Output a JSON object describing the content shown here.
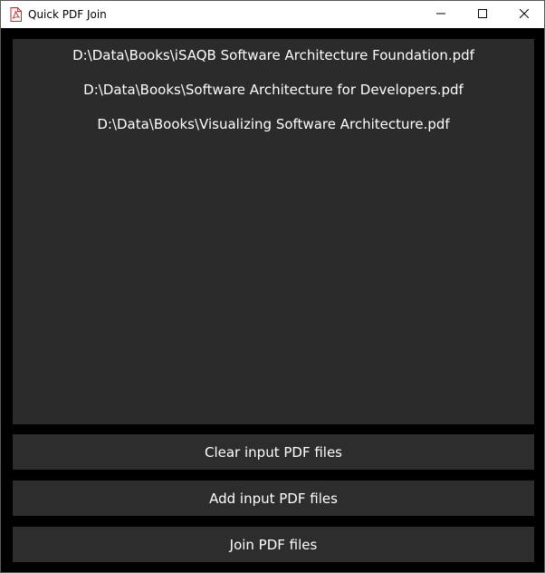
{
  "window": {
    "title": "Quick PDF Join",
    "app_icon": "pdf-document-icon",
    "controls": {
      "minimize_icon": "minimize-icon",
      "maximize_icon": "maximize-icon",
      "close_icon": "close-icon"
    }
  },
  "file_list": {
    "items": [
      "D:\\Data\\Books\\iSAQB Software Architecture Foundation.pdf",
      "D:\\Data\\Books\\Software Architecture for Developers.pdf",
      "D:\\Data\\Books\\Visualizing Software Architecture.pdf"
    ]
  },
  "buttons": {
    "clear_label": "Clear input PDF files",
    "add_label": "Add input PDF files",
    "join_label": "Join PDF files"
  },
  "colors": {
    "background": "#000000",
    "panel": "#2b2b2b",
    "button": "#2d2d2d",
    "text": "#ffffff",
    "icon_accent": "#d32f2f"
  }
}
